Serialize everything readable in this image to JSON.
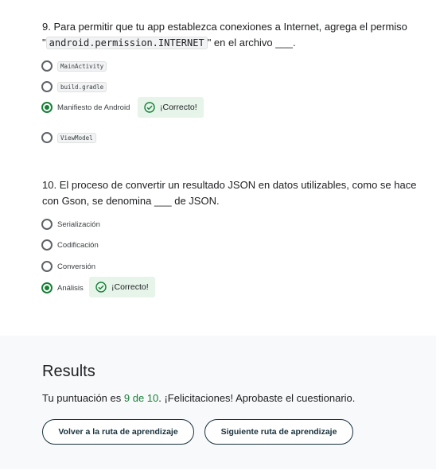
{
  "q9": {
    "num": "9.",
    "text_a": "Para permitir que tu app establezca conexiones a Internet, agrega el permiso",
    "quote_open": "\"",
    "code": "android.permission.INTERNET",
    "text_b": "\" en el archivo ___.",
    "options": [
      "MainActivity",
      "build.gradle",
      "Manifiesto de Android",
      "ViewModel"
    ],
    "selected": 2,
    "feedback": "¡Correcto!"
  },
  "q10": {
    "num": "10.",
    "text": "El proceso de convertir un resultado JSON en datos utilizables, como se hace con Gson, se denomina ___ de JSON.",
    "options": [
      "Serialización",
      "Codificación",
      "Conversión",
      "Análisis"
    ],
    "selected": 3,
    "feedback": "¡Correcto!"
  },
  "results": {
    "title": "Results",
    "text_a": "Tu puntuación es ",
    "score": "9 de 10",
    "text_b": ". ¡Felicitaciones! Aprobaste el cuestionario.",
    "back_button": "Volver a la ruta de aprendizaje",
    "next_button": "Siguiente ruta de aprendizaje"
  },
  "colors": {
    "accent": "#188038",
    "badge_bg": "#e6f4ea",
    "button_border": "#17313b"
  }
}
